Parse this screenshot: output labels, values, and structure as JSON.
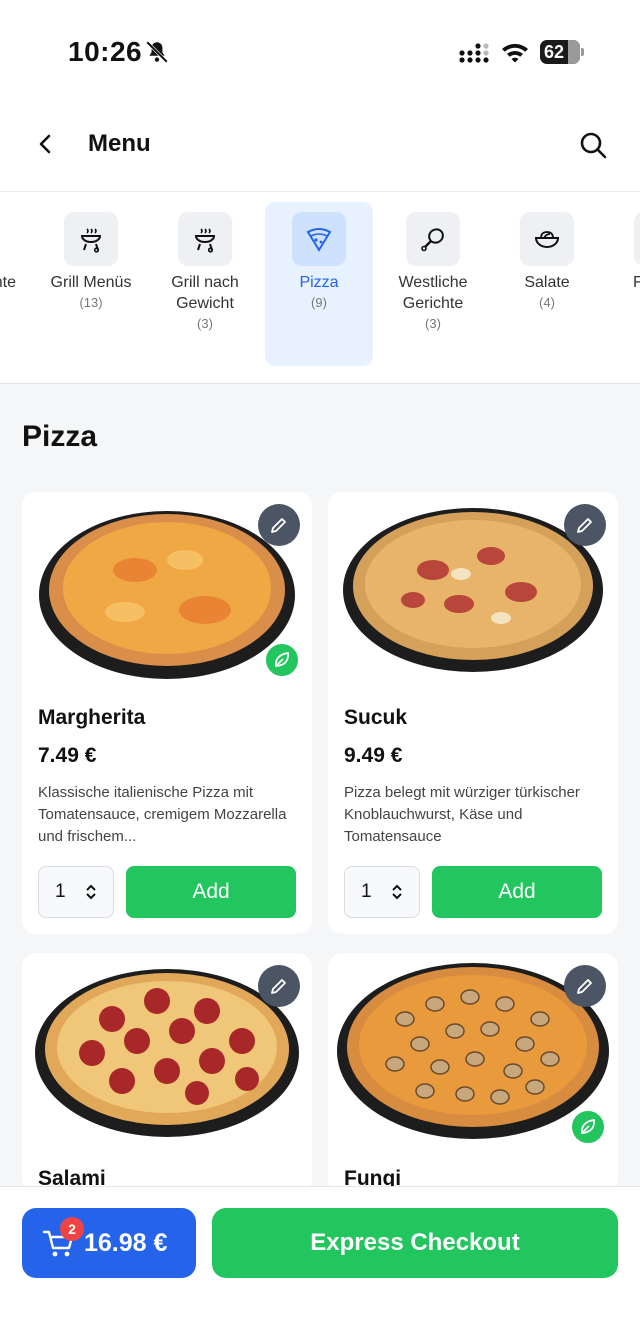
{
  "statusbar": {
    "time": "10:26",
    "battery": "62"
  },
  "header": {
    "title": "Menu"
  },
  "categories": [
    {
      "name": "ichte",
      "count": ""
    },
    {
      "name": "Grill Menüs",
      "count": "(13)"
    },
    {
      "name": "Grill nach Gewicht",
      "count": "(3)"
    },
    {
      "name": "Pizza",
      "count": "(9)",
      "active": true
    },
    {
      "name": "Westliche Gerichte",
      "count": "(3)"
    },
    {
      "name": "Salate",
      "count": "(4)"
    },
    {
      "name": "F",
      "count": ""
    }
  ],
  "section": {
    "title": "Pizza"
  },
  "products": [
    {
      "name": "Margherita",
      "price": "7.49 €",
      "description": "Klassische italienische Pizza mit Tomatensauce, cremigem Mozzarella und frischem...",
      "qty": "1",
      "add_label": "Add",
      "vegetarian": true
    },
    {
      "name": "Sucuk",
      "price": "9.49 €",
      "description": "Pizza belegt mit würziger türkischer Knoblauchwurst, Käse und Tomatensauce",
      "qty": "1",
      "add_label": "Add",
      "vegetarian": false
    },
    {
      "name": "Salami",
      "vegetarian": false
    },
    {
      "name": "Fungi",
      "vegetarian": true
    }
  ],
  "cart": {
    "count": "2",
    "total": "16.98 €"
  },
  "checkout": {
    "label": "Express Checkout"
  },
  "colors": {
    "primary_blue": "#2563eb",
    "green": "#22c55e",
    "badge_red": "#ef4444"
  }
}
